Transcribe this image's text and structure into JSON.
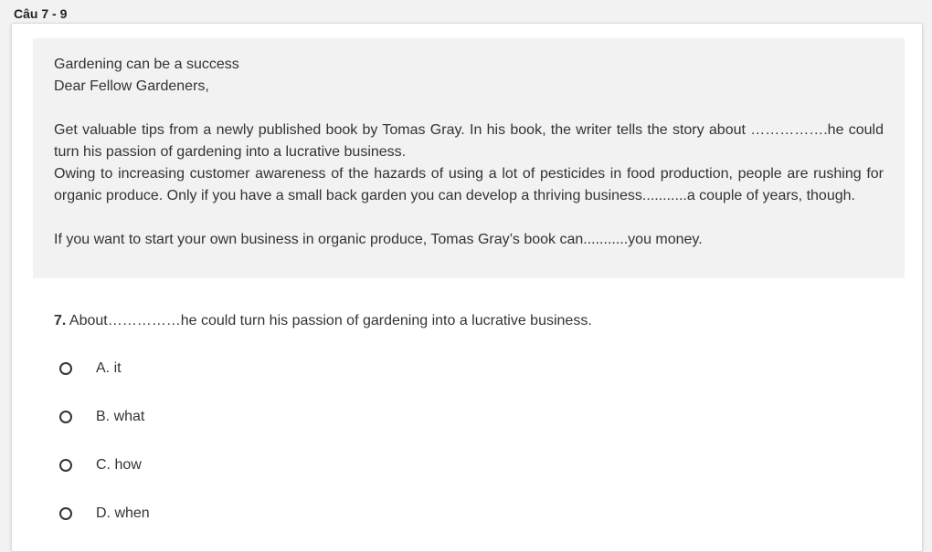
{
  "section": {
    "title": "Câu 7 - 9"
  },
  "passage": {
    "lines": [
      "Gardening can be a success",
      "Dear Fellow Gardeners,",
      "",
      "Get valuable tips from a newly published book by Tomas Gray. In his book, the writer tells the story about …………….he could turn his passion of gardening into a lucrative business.",
      "Owing to increasing customer awareness of the hazards of using a lot of pesticides in food production, people are rushing for organic produce. Only if you have a small back garden you can develop a thriving business...........a couple of years, though.",
      "",
      "If you want to start your own business in organic produce, Tomas Gray’s book can...........you money."
    ]
  },
  "question": {
    "number": "7.",
    "text": "About……………he could turn his passion of gardening into a lucrative business.",
    "options": [
      {
        "label": "A. it"
      },
      {
        "label": "B. what"
      },
      {
        "label": "C. how"
      },
      {
        "label": "D. when"
      }
    ]
  },
  "colors": {
    "page_background": "#f2f2f2",
    "card_background": "#ffffff",
    "passage_background": "#f2f2f2",
    "text": "#333333"
  }
}
